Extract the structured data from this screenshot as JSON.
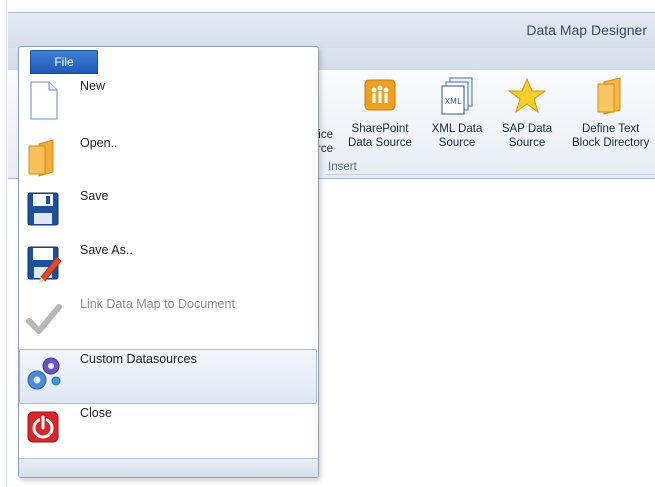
{
  "window": {
    "title": "Data Map Designer"
  },
  "file_tab": {
    "label": "File"
  },
  "menu": {
    "items": [
      {
        "label": "New"
      },
      {
        "label": "Open.."
      },
      {
        "label": "Save"
      },
      {
        "label": "Save As.."
      },
      {
        "label": "Link Data Map to Document"
      },
      {
        "label": "Custom Datasources"
      },
      {
        "label": "Close"
      }
    ]
  },
  "ribbon": {
    "partial_label_line1": "ice",
    "partial_label_line2": "rce",
    "buttons": [
      {
        "line1": "SharePoint",
        "line2": "Data Source",
        "icon": "sharepoint-icon"
      },
      {
        "line1": "XML Data",
        "line2": "Source",
        "icon": "xml-icon"
      },
      {
        "line1": "SAP Data",
        "line2": "Source",
        "icon": "star-icon"
      },
      {
        "line1": "Define Text",
        "line2": "Block Directory",
        "icon": "folder-icon"
      }
    ],
    "group_label": "Insert"
  },
  "colors": {
    "accent": "#1f5bb8",
    "close_red": "#d8262a",
    "hover_bg": "#dde7f3"
  }
}
